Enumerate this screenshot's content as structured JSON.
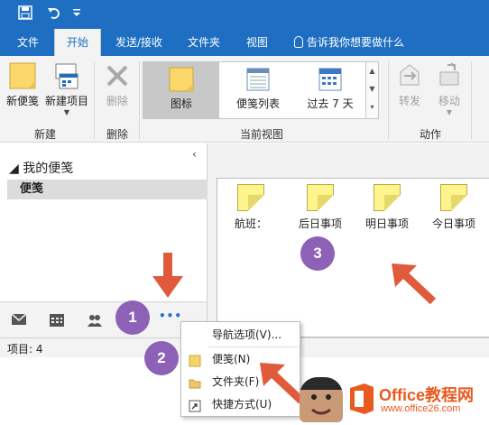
{
  "tabs": [
    "文件",
    "开始",
    "发送/接收",
    "文件夹",
    "视图"
  ],
  "tell_me": "告诉我你想要做什么",
  "ribbon": {
    "new_note": "新便笺",
    "new_item": "新建项目",
    "delete": "删除",
    "gallery": [
      "图标",
      "便笺列表",
      "过去 7 天"
    ],
    "forward": "转发",
    "move": "移动",
    "groups": {
      "new": "新建",
      "delete": "删除",
      "current_view": "当前视图",
      "actions": "动作"
    }
  },
  "nav": {
    "collapse_glyph": "‹",
    "my_notes": "◢ 我的便笺",
    "notes_folder": "便笺",
    "more_glyph": "•••"
  },
  "notes": [
    "航班：",
    "后日事项",
    "明日事项",
    "今日事项"
  ],
  "status": {
    "items": "项目: 4"
  },
  "menu": {
    "nav_options": "导航选项(V)...",
    "notes": "便笺(N)",
    "folders": "文件夹(F)",
    "shortcuts": "快捷方式(U)"
  },
  "badges": [
    "1",
    "2",
    "3"
  ],
  "watermark": {
    "brand": "Office教程网",
    "url": "www.office26.com"
  },
  "colors": {
    "accent": "#1e6fc1",
    "badge": "#8c61b6",
    "arrow": "#e05a3c",
    "note": "#fdf48b"
  }
}
